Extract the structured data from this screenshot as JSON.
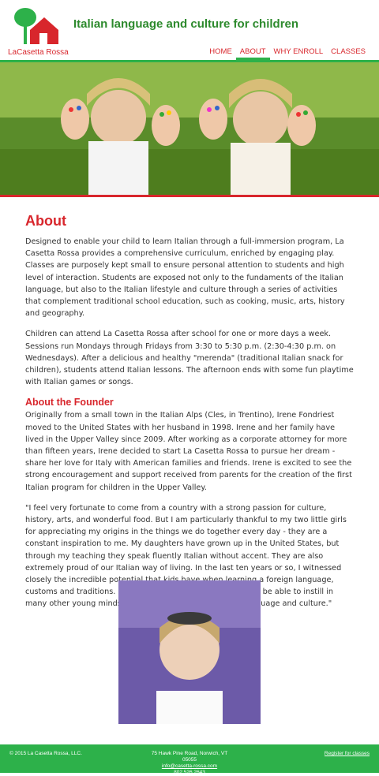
{
  "brand": {
    "logo_text": "LaCasetta Rossa",
    "tagline": "Italian language and culture for children"
  },
  "nav": {
    "items": [
      {
        "label": "HOME"
      },
      {
        "label": "ABOUT"
      },
      {
        "label": "WHY ENROLL"
      },
      {
        "label": "CLASSES"
      }
    ],
    "active": "ABOUT"
  },
  "about": {
    "heading": "About",
    "p1": "Designed to enable your child to learn Italian through a full-immersion program, La Casetta Rossa provides a comprehensive curriculum, enriched by engaging play. Classes are purposely kept small to ensure personal attention to students and high level of interaction. Students are exposed not only to the fundaments of the Italian language, but also to the Italian lifestyle and culture through a series of activities that complement traditional school education, such as cooking, music, arts, history and geography.",
    "p2": "Children can attend La Casetta Rossa after school for one or more days a week. Sessions run Mondays through Fridays from 3:30 to 5:30 p.m. (2:30-4:30 p.m. on Wednesdays). After a delicious and healthy \"merenda\" (traditional Italian snack for children), students attend Italian lessons. The afternoon ends with some fun playtime with Italian games or songs."
  },
  "founder": {
    "heading": "About the Founder",
    "p1": "Originally from a small town in the Italian Alps (Cles, in Trentino), Irene Fondriest moved to the United States with her husband in 1998. Irene and her family have lived in the Upper Valley since 2009. After working as a corporate attorney for more than fifteen years, Irene decided to start La Casetta Rossa to pursue her dream - share her love for Italy with American families and friends. Irene is excited to see the strong encouragement and support received from parents for the creation of the first Italian program for children in the Upper Valley.",
    "quote": "\"I feel very fortunate to come from a country with a strong passion for culture, history, arts, and wonderful food. But I am particularly thankful to my two little girls for appreciating my origins in the things we do together every day - they are a constant inspiration to me. My daughters have grown up in the United States, but through my teaching they speak fluently Italian without accent. They are also extremely proud of our Italian way of living. In the last ten years or so, I witnessed closely the incredible potential that kids have when learning a foreign language, customs and traditions. My hope is that La Casetta Rossa will be able to instill in many other young minds a desire to embrace the Italian language and culture.\""
  },
  "footer": {
    "copyright": "© 2015 La Casetta Rossa, LLC.",
    "address": "75 Hawk Pine Road, Norwich, VT 05055",
    "email": "info@casetta-rossa.com",
    "phone": "802.526.2643",
    "register": "Register for classes"
  },
  "colors": {
    "red": "#d8262c",
    "green": "#2db14a"
  }
}
